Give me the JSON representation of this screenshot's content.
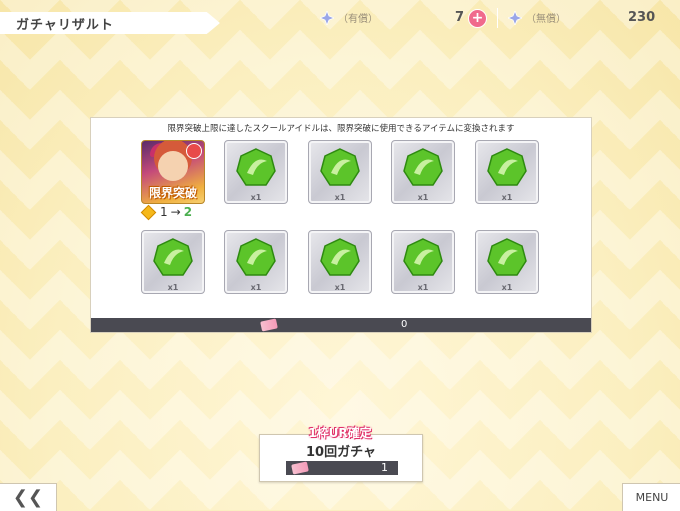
{
  "header": {
    "title": "ガチャリザルト",
    "paid_label": "（有償）",
    "paid_value": "7",
    "free_label": "（無償）",
    "free_value": "230"
  },
  "panel": {
    "note": "限界突破上限に達したスクールアイドルは、限界突破に使用できるアイテムに変換されます",
    "idol_label": "限界突破",
    "limit_from": "1",
    "limit_arrow": "→",
    "limit_to": "2",
    "tiles": [
      {
        "count": "x1"
      },
      {
        "count": "x1"
      },
      {
        "count": "x1"
      },
      {
        "count": "x1"
      },
      {
        "count": "x1"
      },
      {
        "count": "x1"
      },
      {
        "count": "x1"
      },
      {
        "count": "x1"
      },
      {
        "count": "x1"
      }
    ],
    "footer_count": "0"
  },
  "gacha": {
    "tag": "1枠UR確定",
    "label": "10回ガチャ",
    "ticket_count": "1"
  },
  "nav": {
    "back_label": "❮❮",
    "menu_label": "MENU"
  },
  "colors": {
    "background": "#fbefc0",
    "accent_pink": "#f06a8c",
    "gem_green": "#5cc42a",
    "footer_dark": "#4a4a52"
  }
}
